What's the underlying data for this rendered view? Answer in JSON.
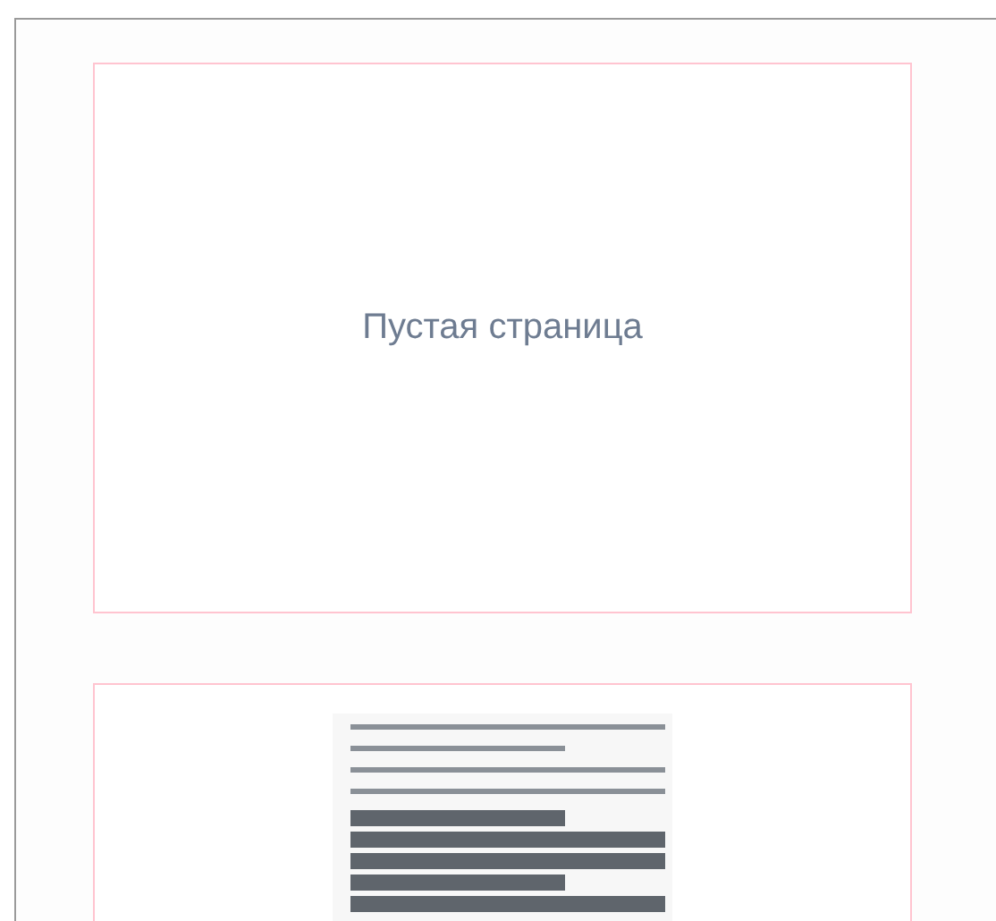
{
  "pages": [
    {
      "kind": "empty",
      "label": "Пустая страница"
    },
    {
      "kind": "scan"
    }
  ]
}
